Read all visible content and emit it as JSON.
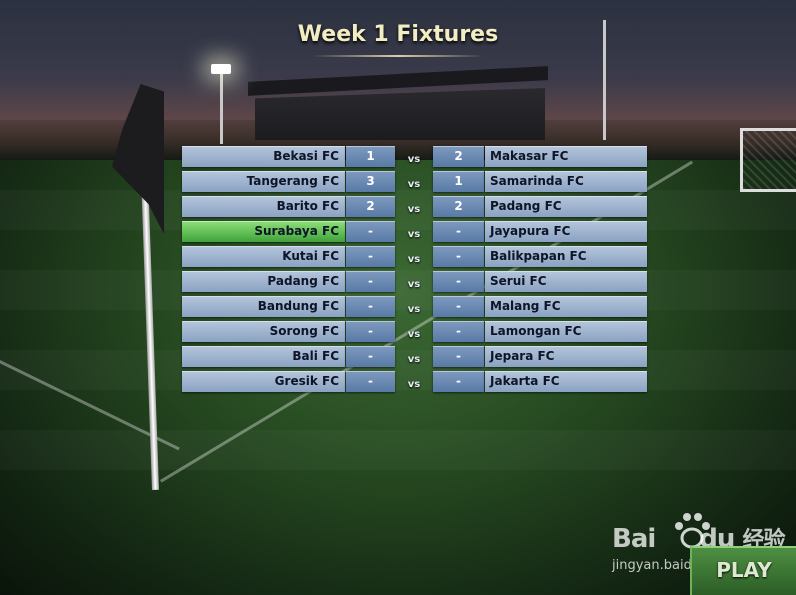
{
  "title": "Week 1 Fixtures",
  "vs_label": "vs",
  "fixtures": [
    {
      "home": "Bekasi FC",
      "home_score": "1",
      "away_score": "2",
      "away": "Makasar FC",
      "highlight": false
    },
    {
      "home": "Tangerang FC",
      "home_score": "3",
      "away_score": "1",
      "away": "Samarinda FC",
      "highlight": false
    },
    {
      "home": "Barito FC",
      "home_score": "2",
      "away_score": "2",
      "away": "Padang FC",
      "highlight": false
    },
    {
      "home": "Surabaya FC",
      "home_score": "-",
      "away_score": "-",
      "away": "Jayapura FC",
      "highlight": true
    },
    {
      "home": "Kutai FC",
      "home_score": "-",
      "away_score": "-",
      "away": "Balikpapan FC",
      "highlight": false
    },
    {
      "home": "Padang FC",
      "home_score": "-",
      "away_score": "-",
      "away": "Serui FC",
      "highlight": false
    },
    {
      "home": "Bandung FC",
      "home_score": "-",
      "away_score": "-",
      "away": "Malang FC",
      "highlight": false
    },
    {
      "home": "Sorong FC",
      "home_score": "-",
      "away_score": "-",
      "away": "Lamongan FC",
      "highlight": false
    },
    {
      "home": "Bali FC",
      "home_score": "-",
      "away_score": "-",
      "away": "Jepara FC",
      "highlight": false
    },
    {
      "home": "Gresik FC",
      "home_score": "-",
      "away_score": "-",
      "away": "Jakarta FC",
      "highlight": false
    }
  ],
  "play_button": "PLAY",
  "watermark": {
    "logo": "Bai负 du 经验",
    "logo_left": "Bai",
    "logo_right": "du",
    "logo_cn": "经验",
    "sub": "jingyan.baidu.com"
  },
  "colors": {
    "title": "#f3eec2",
    "cell": "#9fb4d0",
    "score_cell": "#6c8ab3",
    "highlight": "#5cc048",
    "play": "#3f7a36"
  }
}
